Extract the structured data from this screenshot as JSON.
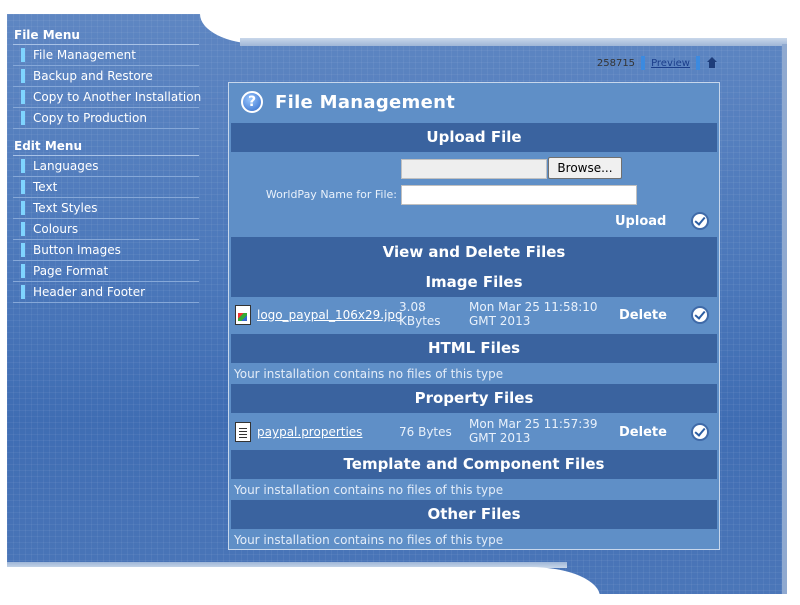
{
  "sidebar": {
    "file_menu_title": "File Menu",
    "file_menu_items": [
      "File Management",
      "Backup and Restore",
      "Copy to Another Installation",
      "Copy to Production"
    ],
    "edit_menu_title": "Edit Menu",
    "edit_menu_items": [
      "Languages",
      "Text",
      "Text Styles",
      "Colours",
      "Button Images",
      "Page Format",
      "Header and Footer"
    ]
  },
  "toplinks": {
    "installation_id": "258715",
    "preview_label": "Preview",
    "home_icon": "home-icon"
  },
  "panel": {
    "title": "File Management",
    "help_icon": "help-icon"
  },
  "upload": {
    "heading": "Upload File",
    "browse_label": "Browse...",
    "file_value": "",
    "worldpay_label": "WorldPay Name for File:",
    "worldpay_value": "",
    "upload_label": "Upload"
  },
  "view_delete": {
    "heading": "View and Delete Files",
    "image_heading": "Image Files",
    "image_file": {
      "name": "logo_paypal_106x29.jpg",
      "size_line1": "3.08",
      "size_line2": "KBytes",
      "date_line1": "Mon Mar 25 11:58:10",
      "date_line2": "GMT 2013",
      "delete_label": "Delete"
    },
    "html_heading": "HTML Files",
    "html_empty": "Your installation contains no files of this type",
    "property_heading": "Property Files",
    "property_file": {
      "name": "paypal.properties",
      "size_line1": "76 Bytes",
      "date_line1": "Mon Mar 25 11:57:39",
      "date_line2": "GMT 2013",
      "delete_label": "Delete"
    },
    "template_heading": "Template and Component Files",
    "template_empty": "Your installation contains no files of this type",
    "other_heading": "Other Files",
    "other_empty": "Your installation contains no files of this type"
  }
}
